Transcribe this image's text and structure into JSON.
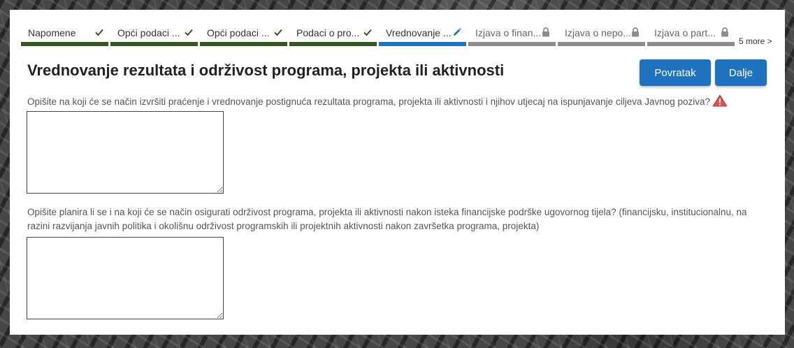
{
  "colors": {
    "completed_bar": "#375623",
    "active_bar": "#1f72c0",
    "locked_bar": "#8c8c8c",
    "button_bg": "#1f72c0",
    "warning": "#d9534f"
  },
  "steps": [
    {
      "label": "Napomene",
      "state": "completed",
      "icon": "check-icon"
    },
    {
      "label": "Opći podaci ...",
      "state": "completed",
      "icon": "check-icon"
    },
    {
      "label": "Opći podaci ...",
      "state": "completed",
      "icon": "check-icon"
    },
    {
      "label": "Podaci o pro...",
      "state": "completed",
      "icon": "check-icon"
    },
    {
      "label": "Vrednovanje ...",
      "state": "active",
      "icon": "pencil-icon"
    },
    {
      "label": "Izjava o finan...",
      "state": "locked",
      "icon": "lock-icon"
    },
    {
      "label": "Izjava o nepo...",
      "state": "locked",
      "icon": "lock-icon"
    },
    {
      "label": "Izjava o part...",
      "state": "locked",
      "icon": "lock-icon"
    }
  ],
  "more_steps": "5 more >",
  "page_title": "Vrednovanje rezultata i održivost programa, projekta ili aktivnosti",
  "buttons": {
    "back_label": "Povratak",
    "next_label": "Dalje"
  },
  "questions": [
    {
      "text": "Opišite na koji će se način izvršiti praćenje i vrednovanje postignuća rezultata programa, projekta ili aktivnosti i njihov utjecaj na ispunjavanje ciljeva Javnog poziva?",
      "value": "",
      "warning_icon": "warning-icon"
    },
    {
      "text": "Opišite planira li se i na koji će se način osigurati održivost programa, projekta ili aktivnosti nakon isteka financijske podrške ugovornog tijela? (financijsku, institucionalnu, na razini razvijanja javnih politika i okolišnu održivost programskih ili projektnih aktivnosti nakon završetka programa, projekta)",
      "value": ""
    }
  ]
}
